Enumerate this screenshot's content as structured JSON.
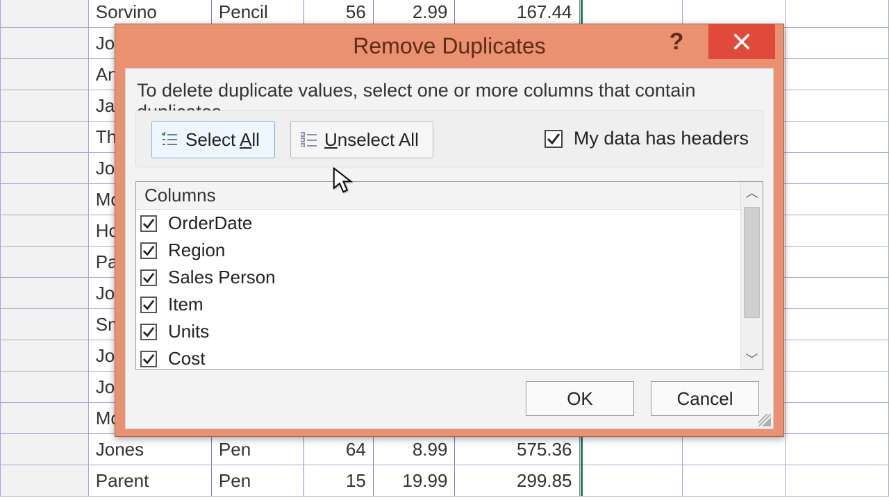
{
  "sheet_rows": [
    {
      "name": "Sorvino",
      "item": "Pencil",
      "units": "56",
      "cost": "2.99",
      "total": "167.44"
    },
    {
      "name": "Jor",
      "item": "",
      "units": "",
      "cost": "",
      "total": ""
    },
    {
      "name": "An",
      "item": "",
      "units": "",
      "cost": "",
      "total": ""
    },
    {
      "name": "Jar",
      "item": "",
      "units": "",
      "cost": "",
      "total": ""
    },
    {
      "name": "Th",
      "item": "",
      "units": "",
      "cost": "",
      "total": ""
    },
    {
      "name": "Jor",
      "item": "",
      "units": "",
      "cost": "",
      "total": ""
    },
    {
      "name": "Mo",
      "item": "",
      "units": "",
      "cost": "",
      "total": ""
    },
    {
      "name": "Ho",
      "item": "",
      "units": "",
      "cost": "",
      "total": ""
    },
    {
      "name": "Pa",
      "item": "",
      "units": "",
      "cost": "",
      "total": ""
    },
    {
      "name": "Jor",
      "item": "",
      "units": "",
      "cost": "",
      "total": ""
    },
    {
      "name": "Sm",
      "item": "",
      "units": "",
      "cost": "",
      "total": ""
    },
    {
      "name": "Jor",
      "item": "",
      "units": "",
      "cost": "",
      "total": ""
    },
    {
      "name": "Jor",
      "item": "",
      "units": "",
      "cost": "",
      "total": ""
    },
    {
      "name": "Mo",
      "item": "",
      "units": "",
      "cost": "",
      "total": ""
    },
    {
      "name": "Jones",
      "item": "Pen",
      "units": "64",
      "cost": "8.99",
      "total": "575.36"
    },
    {
      "name": "Parent",
      "item": "Pen",
      "units": "15",
      "cost": "19.99",
      "total": "299.85"
    }
  ],
  "dialog": {
    "title": "Remove Duplicates",
    "help_tooltip": "?",
    "instruction": "To delete duplicate values, select one or more columns that contain duplicates.",
    "select_all_prefix": "Select ",
    "select_all_mnemonic": "A",
    "select_all_suffix": "ll",
    "unselect_all_mnemonic": "U",
    "unselect_all_suffix": "nselect All",
    "headers_prefix": "M",
    "headers_suffix": "y data has headers",
    "headers_checked": true,
    "columns_header": "Columns",
    "columns": [
      {
        "label": "OrderDate",
        "checked": true
      },
      {
        "label": "Region",
        "checked": true
      },
      {
        "label": "Sales  Person",
        "checked": true
      },
      {
        "label": "Item",
        "checked": true
      },
      {
        "label": "Units",
        "checked": true
      },
      {
        "label": "Cost",
        "checked": true
      }
    ],
    "ok": "OK",
    "cancel": "Cancel"
  }
}
